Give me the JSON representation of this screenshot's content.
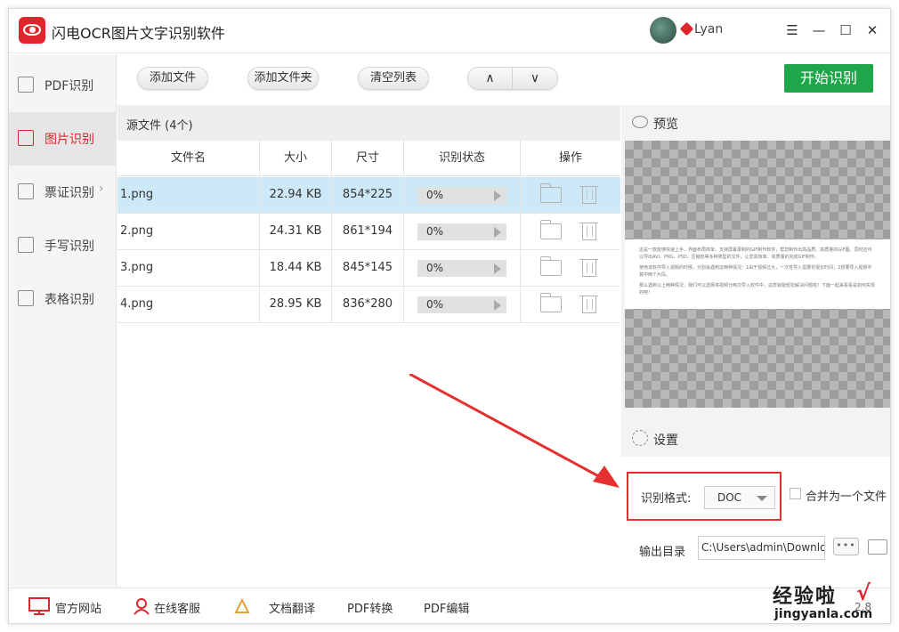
{
  "app": {
    "title": "闪电OCR图片文字识别软件",
    "username": "Lyan"
  },
  "window_controls": {
    "menu": "☰",
    "minimize": "—",
    "maximize": "☐",
    "close": "✕"
  },
  "sidebar": {
    "items": [
      {
        "label": "PDF识别",
        "icon": "pdf-icon"
      },
      {
        "label": "图片识别",
        "icon": "image-icon",
        "active": true
      },
      {
        "label": "票证识别",
        "icon": "ticket-icon",
        "has_submenu": true
      },
      {
        "label": "手写识别",
        "icon": "handwriting-icon"
      },
      {
        "label": "表格识别",
        "icon": "table-icon"
      }
    ]
  },
  "toolbar": {
    "add_file": "添加文件",
    "add_folder": "添加文件夹",
    "clear_list": "清空列表",
    "up": "∧",
    "down": "∨",
    "start": "开始识别"
  },
  "files": {
    "header": "源文件 (4个)",
    "columns": [
      "文件名",
      "大小",
      "尺寸",
      "识别状态",
      "操作"
    ],
    "rows": [
      {
        "name": "1.png",
        "size": "22.94 KB",
        "dim": "854*225",
        "progress": "0%",
        "selected": true
      },
      {
        "name": "2.png",
        "size": "24.31 KB",
        "dim": "861*194",
        "progress": "0%"
      },
      {
        "name": "3.png",
        "size": "18.44 KB",
        "dim": "845*145",
        "progress": "0%"
      },
      {
        "name": "4.png",
        "size": "28.95 KB",
        "dim": "836*280",
        "progress": "0%"
      }
    ]
  },
  "preview": {
    "title": "预览",
    "doc_lines": [
      "这是一款能够快速上手、界面布局简单、支持屏幕录制的GIF制作软件，帮您制作出高品质、高质量的GIF图。同时还可以导出AVI、PNG、PSD，压缩包等多种类型的文件，让您高效率、高质量的完成GIF制作。",
      "使用该软件导入视频的时候，分割会遇到这两种情况：1由于视频过大，一次性导入需要花很长时间；2想要导入视频中其中两个片段。",
      "那么遇到以上两种情况，我们可以选择将视频分两次导入软件中，这样就能轻松解决问题啦！下面一起来看看是如何实现的吧！"
    ]
  },
  "settings": {
    "title": "设置",
    "format_label": "识别格式:",
    "format_value": "DOC",
    "merge_label": "合并为一个文件",
    "output_label": "输出目录",
    "output_path": "C:\\Users\\admin\\Downlo",
    "more_button": "•••"
  },
  "footer": {
    "site": "官方网站",
    "service": "在线客服",
    "translate": "文档翻译",
    "pdf_convert": "PDF转换",
    "pdf_edit": "PDF编辑",
    "version": "2.8"
  },
  "watermark": {
    "top": "经验啦",
    "check": "√",
    "bottom": "jingyanla.com"
  },
  "colors": {
    "accent": "#e0262d",
    "start_button": "#1fa64a",
    "selected_row": "#cde8f6",
    "annotation": "#e53030"
  }
}
